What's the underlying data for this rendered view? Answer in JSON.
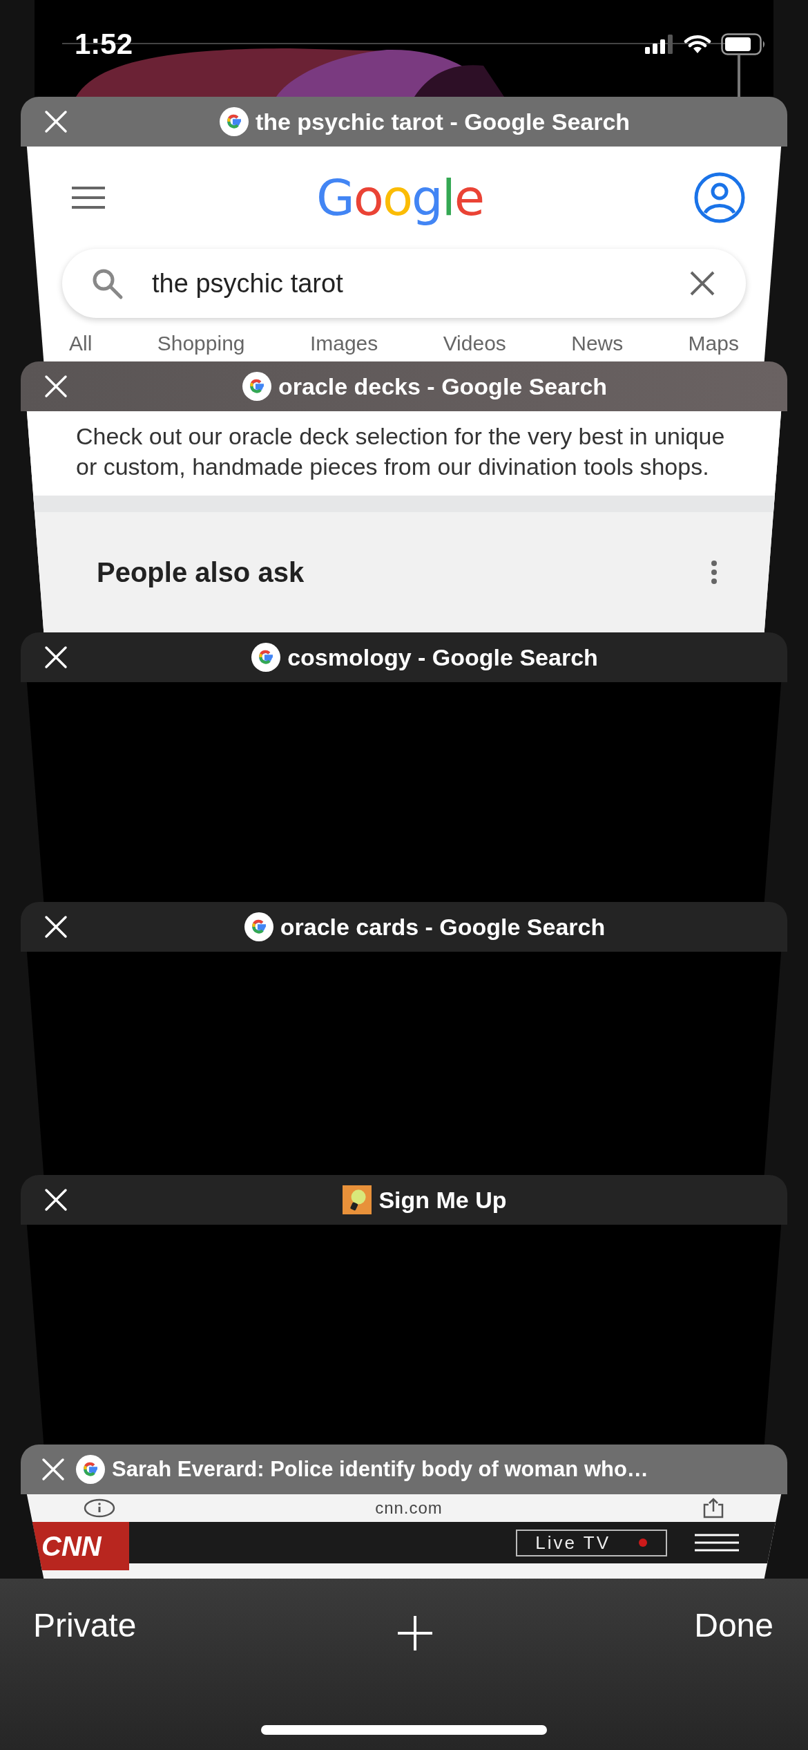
{
  "status_bar": {
    "time": "1:52"
  },
  "tabs": [
    {
      "kind": "google",
      "title": "the psychic tarot - Google Search",
      "preview": {
        "kind": "google_home",
        "logo": "Google",
        "search_value": "the psychic tarot",
        "filters": [
          "All",
          "Shopping",
          "Images",
          "Videos",
          "News",
          "Maps"
        ]
      }
    },
    {
      "kind": "google",
      "title": "oracle decks - Google Search",
      "preview": {
        "kind": "results",
        "snippet": "Check out our oracle deck selection for the very best in unique or custom, handmade pieces from our divination tools shops.",
        "section": "People also ask"
      }
    },
    {
      "kind": "google",
      "title": "cosmology - Google Search",
      "preview": {
        "kind": "blank"
      }
    },
    {
      "kind": "google",
      "title": "oracle cards - Google Search",
      "preview": {
        "kind": "blank"
      }
    },
    {
      "kind": "site",
      "title": "Sign Me Up",
      "preview": {
        "kind": "blank"
      }
    },
    {
      "kind": "google",
      "title": "Sarah Everard: Police identify body of woman who…",
      "preview": {
        "kind": "news",
        "domain": "cnn.com",
        "logo": "CNN",
        "live_label": "Live TV"
      }
    }
  ],
  "toolbar": {
    "left": "Private",
    "right": "Done"
  }
}
